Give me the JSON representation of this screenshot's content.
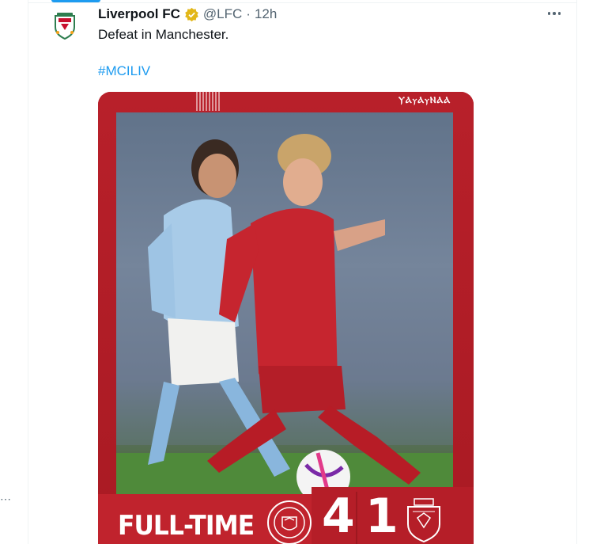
{
  "tweet": {
    "display_name": "Liverpool FC",
    "handle": "@LFC",
    "separator": "·",
    "time": "12h",
    "text": "Defeat in Manchester.",
    "hashtag": "#MCILIV"
  },
  "media": {
    "brand_mark": "ⲨⲀⲩⲀⲩⲚⲀⲀ",
    "fulltime_label": "FULL-TIME",
    "home_score": "4",
    "away_score": "1",
    "home_crest_text": "MANCHESTER CITY",
    "away_crest_text": "LIVERPOOL FOOTBALL CLUB"
  },
  "colors": {
    "accent": "#1d9bf0",
    "verified": "#e2b719",
    "lfc_red": "#c0232d"
  },
  "icons": {
    "more": "more-icon",
    "verified": "verified-badge-icon"
  }
}
